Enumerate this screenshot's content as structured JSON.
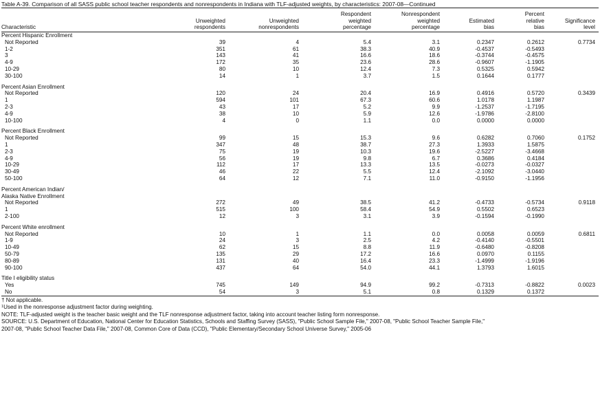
{
  "title": "Table A-39. Comparison of all SASS public school teacher respondents and nonrespondents in Indiana with TLF-adjusted weights, by characteristics: 2007-08—Continued",
  "headers": {
    "characteristic": "Characteristic",
    "unweighted_respondents": "Unweighted\nrespondents",
    "unweighted_nonrespondents": "Unweighted\nnonrespondents",
    "respondent_weighted_pct": "Respondent\nweighted\npercentage",
    "nonrespondent_weighted_pct": "Nonrespondent\nweighted\npercentage",
    "estimated_bias": "Estimated\nbias",
    "percent_relative_bias": "Percent\nrelative\nbias",
    "significance_level": "Significance\nlevel"
  },
  "groups": [
    {
      "title": "Percent Hispanic Enrollment",
      "rows": [
        [
          "Not Reported",
          "39",
          "4",
          "5.4",
          "3.1",
          "0.2347",
          "0.2612",
          "0.7734"
        ],
        [
          "1-2",
          "351",
          "61",
          "38.3",
          "40.9",
          "-0.4537",
          "-0.5493",
          ""
        ],
        [
          "3",
          "143",
          "41",
          "16.6",
          "18.6",
          "-0.3744",
          "-0.4575",
          ""
        ],
        [
          "4-9",
          "172",
          "35",
          "23.6",
          "28.6",
          "-0.9607",
          "-1.1905",
          ""
        ],
        [
          "10-29",
          "80",
          "10",
          "12.4",
          "7.3",
          "0.5325",
          "0.5942",
          ""
        ],
        [
          "30-100",
          "14",
          "1",
          "3.7",
          "1.5",
          "0.1644",
          "0.1777",
          ""
        ]
      ]
    },
    {
      "title": "Percent Asian Enrollment",
      "rows": [
        [
          "Not Reported",
          "120",
          "24",
          "20.4",
          "16.9",
          "0.4916",
          "0.5720",
          "0.3439"
        ],
        [
          "1",
          "594",
          "101",
          "67.3",
          "60.6",
          "1.0178",
          "1.1987",
          ""
        ],
        [
          "2-3",
          "43",
          "17",
          "5.2",
          "9.9",
          "-1.2537",
          "-1.7195",
          ""
        ],
        [
          "4-9",
          "38",
          "10",
          "5.9",
          "12.6",
          "-1.9786",
          "-2.8100",
          ""
        ],
        [
          "10-100",
          "4",
          "0",
          "1.1",
          "0.0",
          "0.0000",
          "0.0000",
          ""
        ]
      ]
    },
    {
      "title": "Percent Black Enrollment",
      "rows": [
        [
          "Not Reported",
          "99",
          "15",
          "15.3",
          "9.6",
          "0.6282",
          "0.7060",
          "0.1752"
        ],
        [
          "1",
          "347",
          "48",
          "38.7",
          "27.3",
          "1.3933",
          "1.5875",
          ""
        ],
        [
          "2-3",
          "75",
          "19",
          "10.3",
          "19.6",
          "-2.5227",
          "-3.4668",
          ""
        ],
        [
          "4-9",
          "56",
          "19",
          "9.8",
          "6.7",
          "0.3686",
          "0.4184",
          ""
        ],
        [
          "10-29",
          "112",
          "17",
          "13.3",
          "13.5",
          "-0.0273",
          "-0.0327",
          ""
        ],
        [
          "30-49",
          "46",
          "22",
          "5.5",
          "12.4",
          "-2.1092",
          "-3.0440",
          ""
        ],
        [
          "50-100",
          "64",
          "12",
          "7.1",
          "11.0",
          "-0.9150",
          "-1.1956",
          ""
        ]
      ]
    },
    {
      "title": "Percent American Indian/",
      "title2": "Alaska Native Enrollment",
      "rows": [
        [
          "Not Reported",
          "272",
          "49",
          "38.5",
          "41.2",
          "-0.4733",
          "-0.5734",
          "0.9118"
        ],
        [
          "1",
          "515",
          "100",
          "58.4",
          "54.9",
          "0.5502",
          "0.6523",
          ""
        ],
        [
          "2-100",
          "12",
          "3",
          "3.1",
          "3.9",
          "-0.1594",
          "-0.1990",
          ""
        ]
      ]
    },
    {
      "title": "Percent White enrollment",
      "rows": [
        [
          "Not Reported",
          "10",
          "1",
          "1.1",
          "0.0",
          "0.0058",
          "0.0059",
          "0.6811"
        ],
        [
          "1-9",
          "24",
          "3",
          "2.5",
          "4.2",
          "-0.4140",
          "-0.5501",
          ""
        ],
        [
          "10-49",
          "62",
          "15",
          "8.8",
          "11.9",
          "-0.6480",
          "-0.8208",
          ""
        ],
        [
          "50-79",
          "135",
          "29",
          "17.2",
          "16.6",
          "0.0970",
          "0.1155",
          ""
        ],
        [
          "80-89",
          "131",
          "40",
          "16.4",
          "23.3",
          "-1.4999",
          "-1.9196",
          ""
        ],
        [
          "90-100",
          "437",
          "64",
          "54.0",
          "44.1",
          "1.3793",
          "1.6015",
          ""
        ]
      ]
    },
    {
      "title": "Title I eligibility status",
      "rows": [
        [
          "Yes",
          "745",
          "149",
          "94.9",
          "99.2",
          "-0.7313",
          "-0.8822",
          "0.0023"
        ],
        [
          "No",
          "54",
          "3",
          "5.1",
          "0.8",
          "0.1329",
          "0.1372",
          ""
        ]
      ]
    }
  ],
  "notes": {
    "dagger": "† Not applicable.",
    "footnote1_mark": "1",
    "footnote1": "Used in the nonresponse adjustment factor during weighting.",
    "note": "NOTE: TLF-adjusted weight is the teacher basic weight and the TLF nonresponse adjustment factor, taking into account teacher listing form nonresponse.",
    "source1": "SOURCE: U.S. Department of Education, National Center for Education Statistics, Schools and Staffing Survey (SASS), \"Public School Sample File,\" 2007-08, \"Public School Teacher Sample File,\"",
    "source2": "2007-08, \"Public School Teacher Data File,\" 2007-08, Common Core of Data (CCD), \"Public Elementary/Secondary School Universe Survey,\" 2005-06"
  }
}
